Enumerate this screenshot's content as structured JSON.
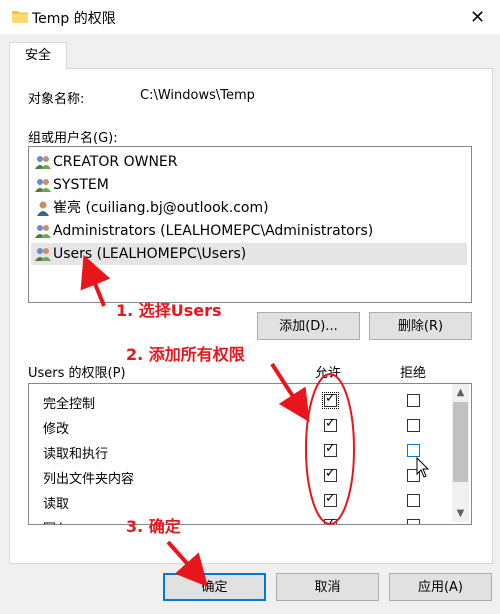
{
  "window": {
    "title": "Temp 的权限",
    "close_glyph": "✕"
  },
  "tab": {
    "label": "安全"
  },
  "object": {
    "label": "对象名称:",
    "value": "C:\\Windows\\Temp"
  },
  "groups": {
    "label": "组或用户名(G):",
    "items": [
      {
        "name": "CREATOR OWNER",
        "icon": "group-icon"
      },
      {
        "name": "SYSTEM",
        "icon": "group-icon"
      },
      {
        "name": "崔亮 (cuiliang.bj@outlook.com)",
        "icon": "user-icon"
      },
      {
        "name": "Administrators (LEALHOMEPC\\Administrators)",
        "icon": "group-icon"
      },
      {
        "name": "Users (LEALHOMEPC\\Users)",
        "icon": "group-icon",
        "selected": true
      }
    ]
  },
  "buttons": {
    "add": "添加(D)...",
    "remove": "删除(R)",
    "ok": "确定",
    "cancel": "取消",
    "apply": "应用(A)"
  },
  "permissions": {
    "label": "Users 的权限(P)",
    "allow_header": "允许",
    "deny_header": "拒绝",
    "rows": [
      {
        "name": "完全控制",
        "allow": true,
        "deny": false
      },
      {
        "name": "修改",
        "allow": true,
        "deny": false
      },
      {
        "name": "读取和执行",
        "allow": true,
        "deny": false
      },
      {
        "name": "列出文件夹内容",
        "allow": true,
        "deny": false
      },
      {
        "name": "读取",
        "allow": true,
        "deny": false
      },
      {
        "name": "写入",
        "allow": true,
        "deny": false
      }
    ]
  },
  "annotations": {
    "step1": "1. 选择Users",
    "step2": "2. 添加所有权限",
    "step3": "3. 确定",
    "color": "#e8161c"
  }
}
